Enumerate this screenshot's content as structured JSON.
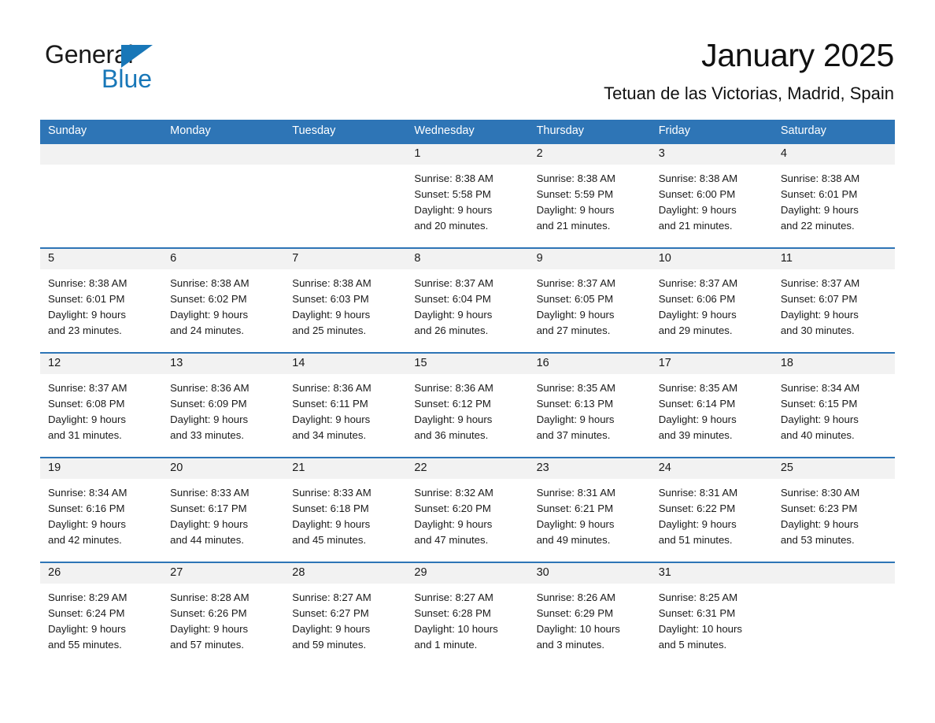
{
  "brand": {
    "logo_text_1": "General",
    "logo_text_2": "Blue",
    "logo_triangle_icon": "triangle-icon",
    "accent_color": "#1877B8",
    "header_color": "#2E75B6",
    "band_color": "#F2F2F2"
  },
  "header": {
    "title": "January 2025",
    "subtitle": "Tetuan de las Victorias, Madrid, Spain"
  },
  "calendar": {
    "day_headers": [
      "Sunday",
      "Monday",
      "Tuesday",
      "Wednesday",
      "Thursday",
      "Friday",
      "Saturday"
    ],
    "weeks": [
      [
        {
          "date": "",
          "lines": []
        },
        {
          "date": "",
          "lines": []
        },
        {
          "date": "",
          "lines": []
        },
        {
          "date": "1",
          "lines": [
            "Sunrise: 8:38 AM",
            "Sunset: 5:58 PM",
            "Daylight: 9 hours",
            "and 20 minutes."
          ]
        },
        {
          "date": "2",
          "lines": [
            "Sunrise: 8:38 AM",
            "Sunset: 5:59 PM",
            "Daylight: 9 hours",
            "and 21 minutes."
          ]
        },
        {
          "date": "3",
          "lines": [
            "Sunrise: 8:38 AM",
            "Sunset: 6:00 PM",
            "Daylight: 9 hours",
            "and 21 minutes."
          ]
        },
        {
          "date": "4",
          "lines": [
            "Sunrise: 8:38 AM",
            "Sunset: 6:01 PM",
            "Daylight: 9 hours",
            "and 22 minutes."
          ]
        }
      ],
      [
        {
          "date": "5",
          "lines": [
            "Sunrise: 8:38 AM",
            "Sunset: 6:01 PM",
            "Daylight: 9 hours",
            "and 23 minutes."
          ]
        },
        {
          "date": "6",
          "lines": [
            "Sunrise: 8:38 AM",
            "Sunset: 6:02 PM",
            "Daylight: 9 hours",
            "and 24 minutes."
          ]
        },
        {
          "date": "7",
          "lines": [
            "Sunrise: 8:38 AM",
            "Sunset: 6:03 PM",
            "Daylight: 9 hours",
            "and 25 minutes."
          ]
        },
        {
          "date": "8",
          "lines": [
            "Sunrise: 8:37 AM",
            "Sunset: 6:04 PM",
            "Daylight: 9 hours",
            "and 26 minutes."
          ]
        },
        {
          "date": "9",
          "lines": [
            "Sunrise: 8:37 AM",
            "Sunset: 6:05 PM",
            "Daylight: 9 hours",
            "and 27 minutes."
          ]
        },
        {
          "date": "10",
          "lines": [
            "Sunrise: 8:37 AM",
            "Sunset: 6:06 PM",
            "Daylight: 9 hours",
            "and 29 minutes."
          ]
        },
        {
          "date": "11",
          "lines": [
            "Sunrise: 8:37 AM",
            "Sunset: 6:07 PM",
            "Daylight: 9 hours",
            "and 30 minutes."
          ]
        }
      ],
      [
        {
          "date": "12",
          "lines": [
            "Sunrise: 8:37 AM",
            "Sunset: 6:08 PM",
            "Daylight: 9 hours",
            "and 31 minutes."
          ]
        },
        {
          "date": "13",
          "lines": [
            "Sunrise: 8:36 AM",
            "Sunset: 6:09 PM",
            "Daylight: 9 hours",
            "and 33 minutes."
          ]
        },
        {
          "date": "14",
          "lines": [
            "Sunrise: 8:36 AM",
            "Sunset: 6:11 PM",
            "Daylight: 9 hours",
            "and 34 minutes."
          ]
        },
        {
          "date": "15",
          "lines": [
            "Sunrise: 8:36 AM",
            "Sunset: 6:12 PM",
            "Daylight: 9 hours",
            "and 36 minutes."
          ]
        },
        {
          "date": "16",
          "lines": [
            "Sunrise: 8:35 AM",
            "Sunset: 6:13 PM",
            "Daylight: 9 hours",
            "and 37 minutes."
          ]
        },
        {
          "date": "17",
          "lines": [
            "Sunrise: 8:35 AM",
            "Sunset: 6:14 PM",
            "Daylight: 9 hours",
            "and 39 minutes."
          ]
        },
        {
          "date": "18",
          "lines": [
            "Sunrise: 8:34 AM",
            "Sunset: 6:15 PM",
            "Daylight: 9 hours",
            "and 40 minutes."
          ]
        }
      ],
      [
        {
          "date": "19",
          "lines": [
            "Sunrise: 8:34 AM",
            "Sunset: 6:16 PM",
            "Daylight: 9 hours",
            "and 42 minutes."
          ]
        },
        {
          "date": "20",
          "lines": [
            "Sunrise: 8:33 AM",
            "Sunset: 6:17 PM",
            "Daylight: 9 hours",
            "and 44 minutes."
          ]
        },
        {
          "date": "21",
          "lines": [
            "Sunrise: 8:33 AM",
            "Sunset: 6:18 PM",
            "Daylight: 9 hours",
            "and 45 minutes."
          ]
        },
        {
          "date": "22",
          "lines": [
            "Sunrise: 8:32 AM",
            "Sunset: 6:20 PM",
            "Daylight: 9 hours",
            "and 47 minutes."
          ]
        },
        {
          "date": "23",
          "lines": [
            "Sunrise: 8:31 AM",
            "Sunset: 6:21 PM",
            "Daylight: 9 hours",
            "and 49 minutes."
          ]
        },
        {
          "date": "24",
          "lines": [
            "Sunrise: 8:31 AM",
            "Sunset: 6:22 PM",
            "Daylight: 9 hours",
            "and 51 minutes."
          ]
        },
        {
          "date": "25",
          "lines": [
            "Sunrise: 8:30 AM",
            "Sunset: 6:23 PM",
            "Daylight: 9 hours",
            "and 53 minutes."
          ]
        }
      ],
      [
        {
          "date": "26",
          "lines": [
            "Sunrise: 8:29 AM",
            "Sunset: 6:24 PM",
            "Daylight: 9 hours",
            "and 55 minutes."
          ]
        },
        {
          "date": "27",
          "lines": [
            "Sunrise: 8:28 AM",
            "Sunset: 6:26 PM",
            "Daylight: 9 hours",
            "and 57 minutes."
          ]
        },
        {
          "date": "28",
          "lines": [
            "Sunrise: 8:27 AM",
            "Sunset: 6:27 PM",
            "Daylight: 9 hours",
            "and 59 minutes."
          ]
        },
        {
          "date": "29",
          "lines": [
            "Sunrise: 8:27 AM",
            "Sunset: 6:28 PM",
            "Daylight: 10 hours",
            "and 1 minute."
          ]
        },
        {
          "date": "30",
          "lines": [
            "Sunrise: 8:26 AM",
            "Sunset: 6:29 PM",
            "Daylight: 10 hours",
            "and 3 minutes."
          ]
        },
        {
          "date": "31",
          "lines": [
            "Sunrise: 8:25 AM",
            "Sunset: 6:31 PM",
            "Daylight: 10 hours",
            "and 5 minutes."
          ]
        },
        {
          "date": "",
          "lines": []
        }
      ]
    ]
  }
}
